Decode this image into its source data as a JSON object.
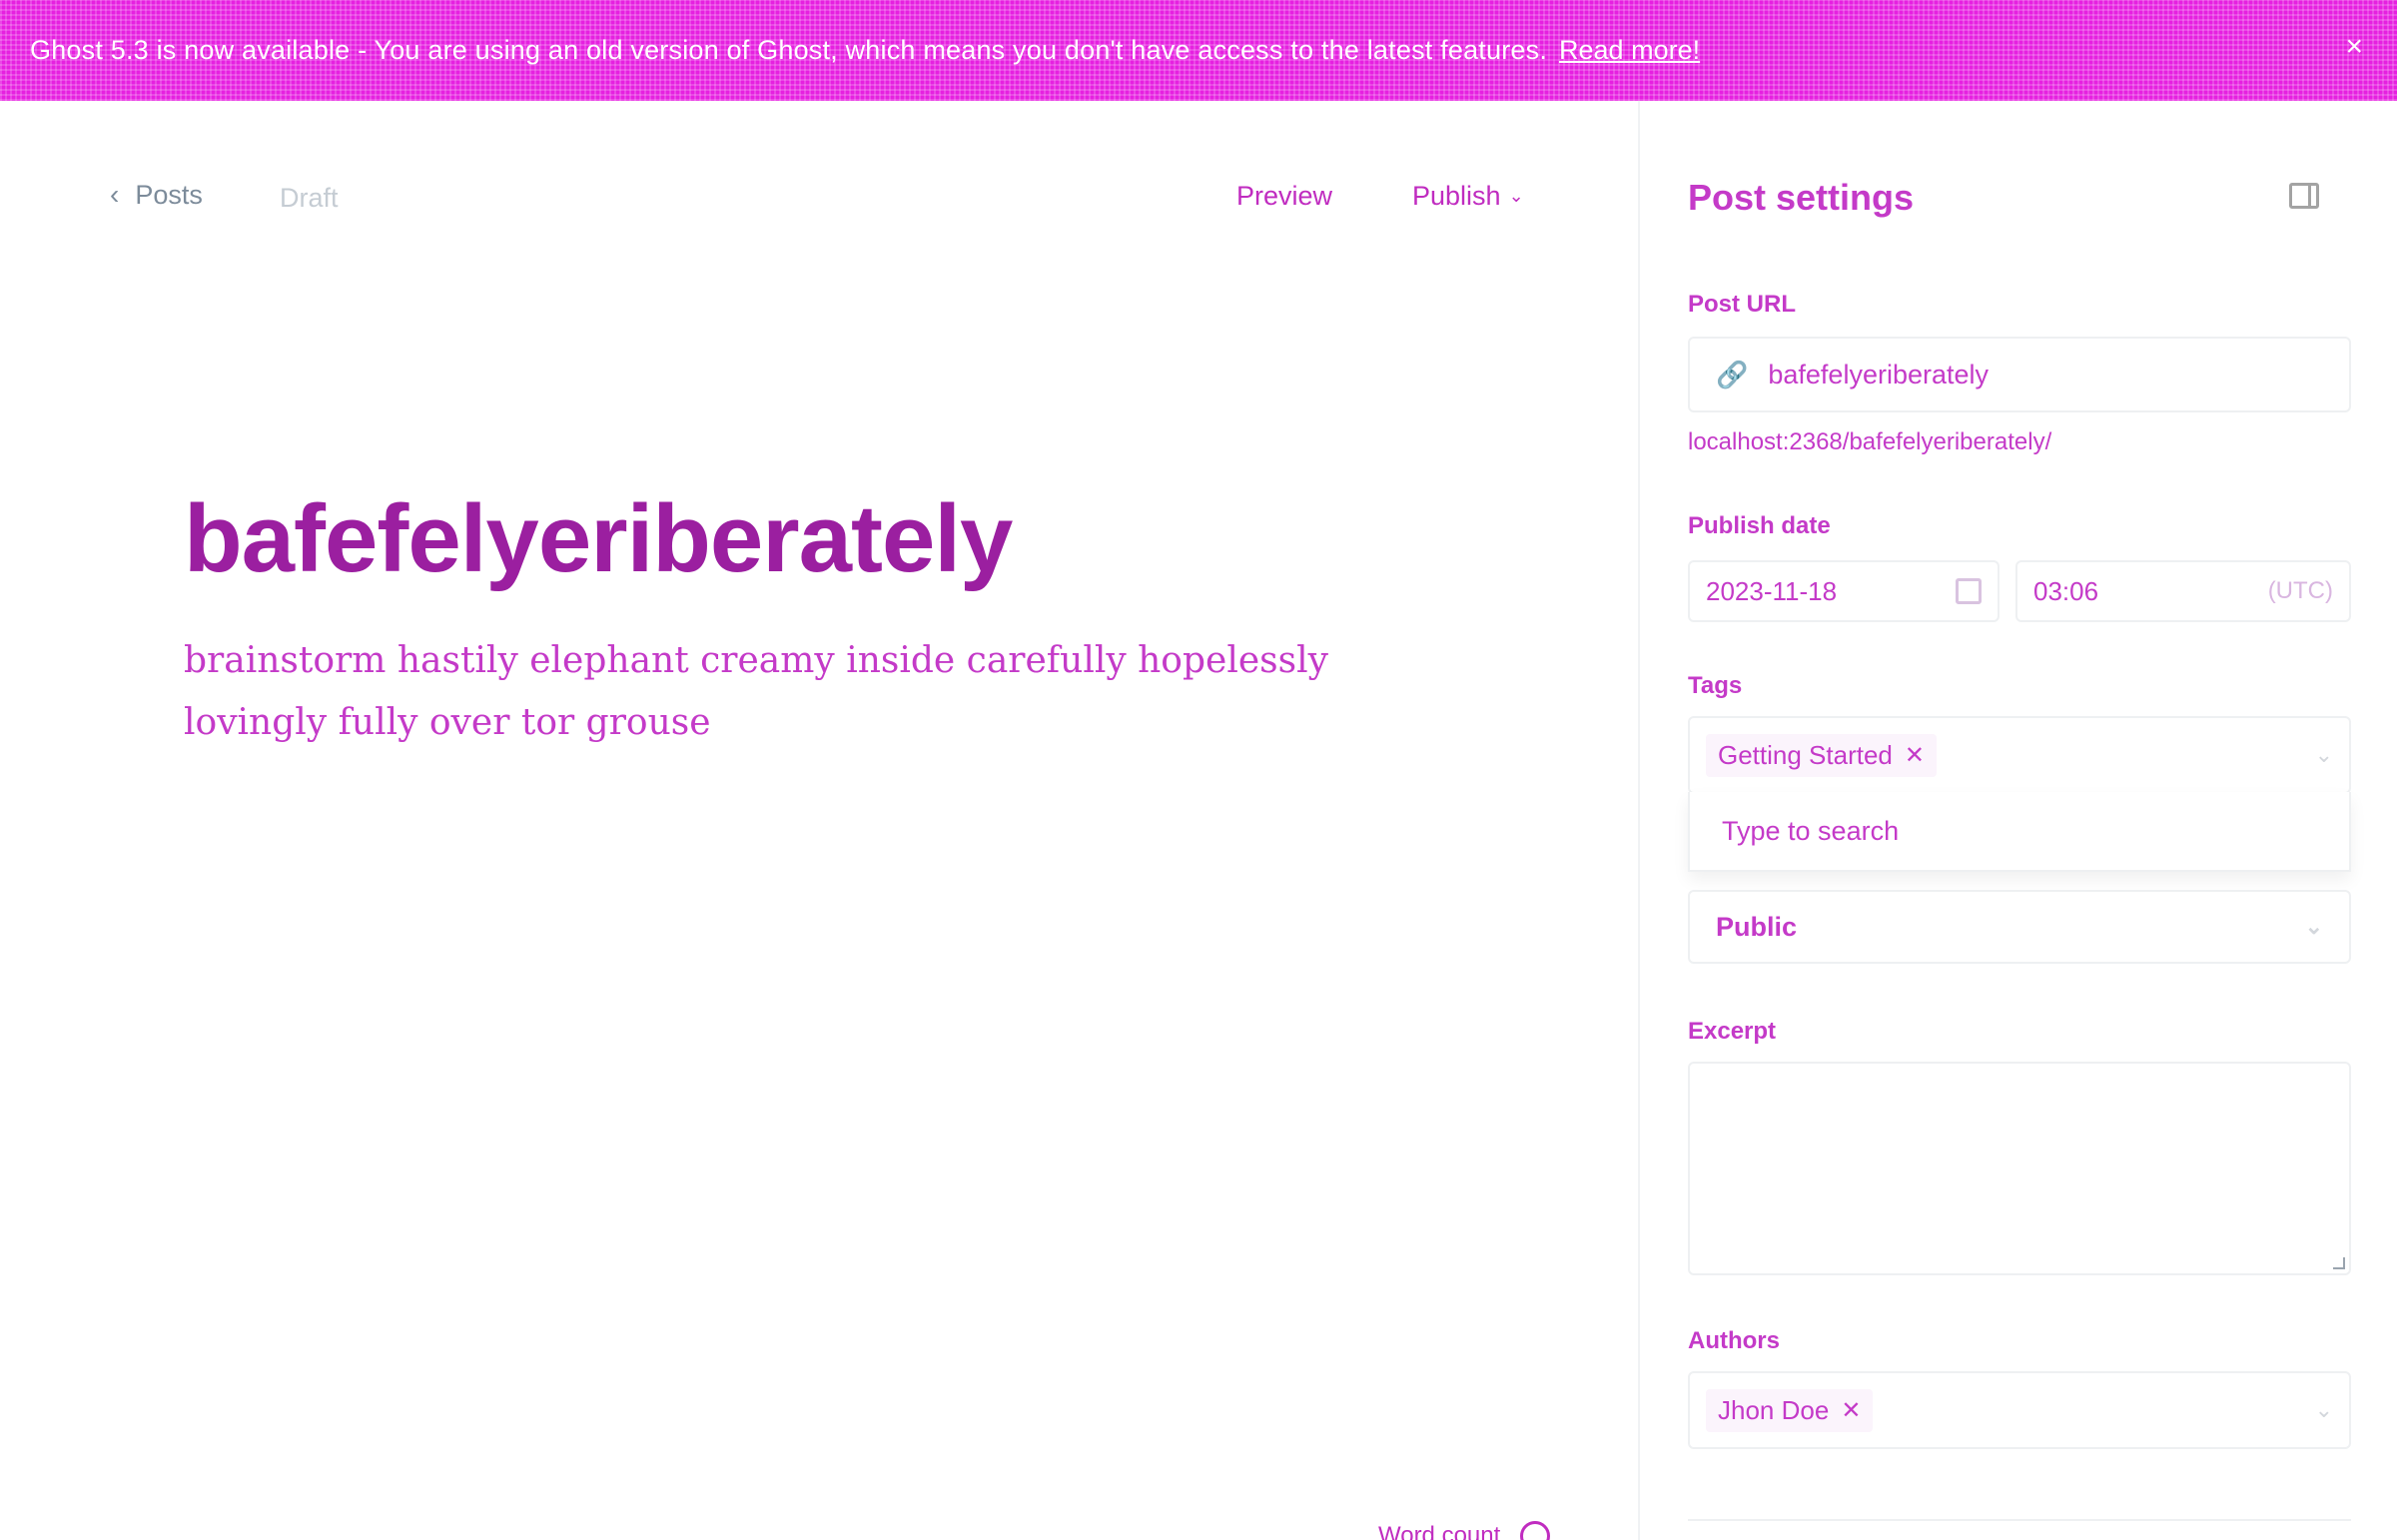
{
  "banner": {
    "text": "Ghost 5.3 is now available - You are using an old version of Ghost, which means you don't have access to the latest features.",
    "link_label": "Read more!",
    "close_label": "×"
  },
  "editor": {
    "back_label": "Posts",
    "status": "Draft",
    "preview_label": "Preview",
    "publish_label": "Publish",
    "title": "bafefelyeriberately",
    "body": "brainstorm hastily elephant creamy inside carefully hopelessly lovingly fully over tor grouse",
    "word_count": "Word count"
  },
  "settings": {
    "title": "Post settings",
    "post_url": {
      "label": "Post URL",
      "value": "bafefelyeriberately",
      "preview": "localhost:2368/bafefelyeriberately/"
    },
    "publish_date": {
      "label": "Publish date",
      "date": "2023-11-18",
      "time": "03:06",
      "timezone": "(UTC)"
    },
    "tags": {
      "label": "Tags",
      "selected": [
        "Getting Started"
      ],
      "search_placeholder": "Type to search"
    },
    "visibility": {
      "value": "Public"
    },
    "excerpt": {
      "label": "Excerpt",
      "value": ""
    },
    "authors": {
      "label": "Authors",
      "selected": [
        "Jhon Doe"
      ]
    }
  },
  "colors": {
    "banner": "#e620e0",
    "accent": "#c43ac8",
    "title": "#9b1fa0"
  }
}
